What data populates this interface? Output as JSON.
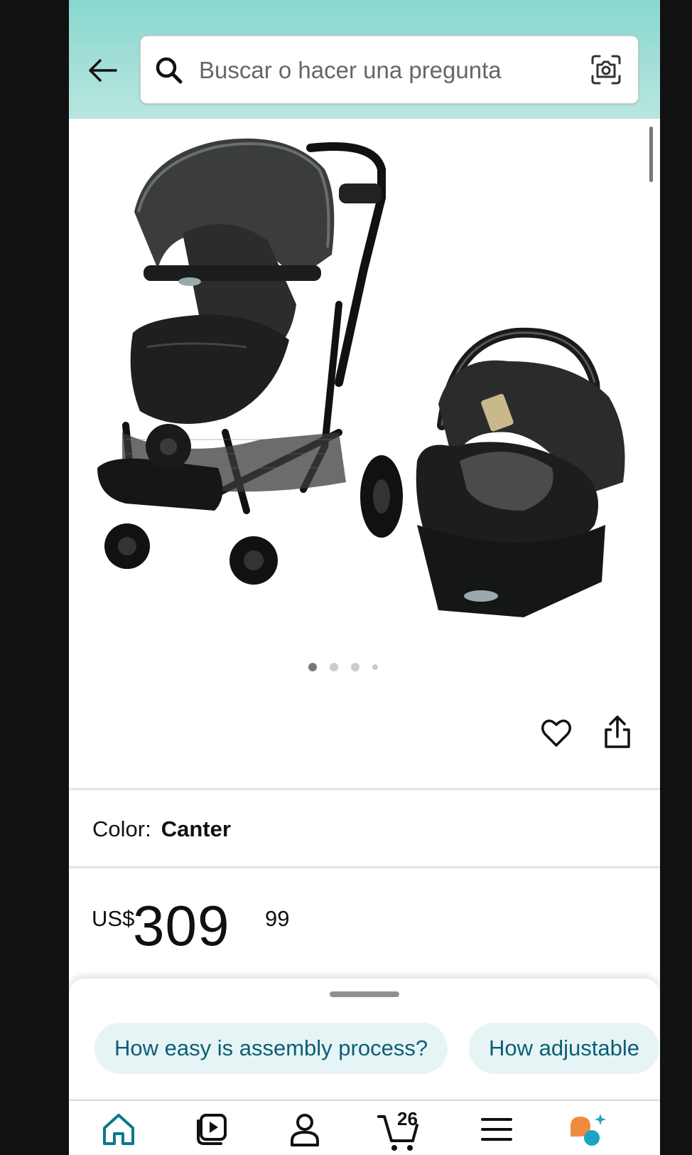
{
  "search": {
    "placeholder": "Buscar o hacer una pregunta"
  },
  "product": {
    "color_label": "Color:",
    "color_value": "Canter",
    "price_currency": "US$",
    "price_whole": "309",
    "price_fraction": "99",
    "image_count": 4,
    "active_image": 1
  },
  "suggestions": [
    {
      "label": "How easy is assembly process?"
    },
    {
      "label": "How adjustable"
    }
  ],
  "bottom_nav": {
    "cart_count": "26",
    "items": [
      "home-icon",
      "video-icon",
      "account-icon",
      "cart-icon",
      "menu-icon",
      "assistant-icon"
    ]
  },
  "colors": {
    "header": "#88d8cf",
    "chip_bg": "#e7f4f6",
    "chip_text": "#0b5f74",
    "assistant_orange": "#f08a3c",
    "assistant_teal": "#1aa5c4"
  }
}
